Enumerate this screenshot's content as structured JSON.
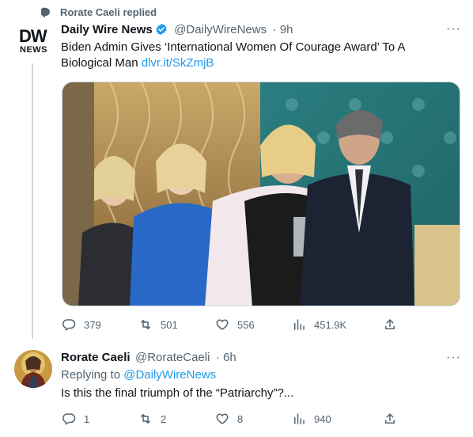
{
  "social_context": {
    "text": "Rorate Caeli replied"
  },
  "tweet1": {
    "avatar_top": "DW",
    "avatar_bottom": "NEWS",
    "name": "Daily Wire News",
    "handle": "@DailyWireNews",
    "time": "· 9h",
    "more": "···",
    "text_line1": "Biden Admin Gives ‘International Women Of Courage Award’ To A",
    "text_line2": "Biological Man",
    "link": "dlvr.it/SkZmjB",
    "stats": {
      "replies": "379",
      "retweets": "501",
      "likes": "556",
      "views": "451.9K"
    }
  },
  "tweet2": {
    "name": "Rorate Caeli",
    "handle": "@RorateCaeli",
    "time": "· 6h",
    "more": "···",
    "replying_prefix": "Replying to",
    "replying_to": "@DailyWireNews",
    "text": "Is this the final triumph of the “Patriarchy”?...",
    "stats": {
      "replies": "1",
      "retweets": "2",
      "likes": "8",
      "views": "940"
    }
  },
  "colors": {
    "accent": "#1d9bf0",
    "muted": "#536471",
    "text": "#0f1419"
  }
}
